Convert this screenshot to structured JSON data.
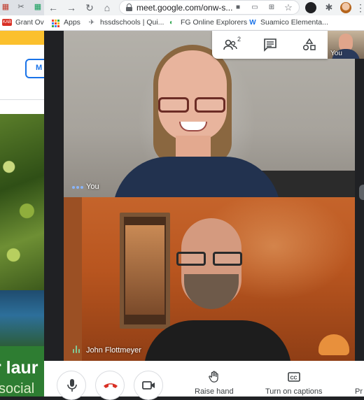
{
  "background_window": {
    "bookmark_badge": "KAB",
    "bookmark_text": "Grant Ove",
    "button_text": "M",
    "banner_text_line1": "r laur",
    "banner_text_line2": "social"
  },
  "browser": {
    "url": "meet.google.com/onw-s...",
    "bookmarks": [
      {
        "label": "Apps",
        "icon": "apps-grid-icon"
      },
      {
        "label": "hssdschools | Qui...",
        "icon": "bird-icon"
      },
      {
        "label": "FG Online Explorers",
        "icon": "fg-logo-icon"
      },
      {
        "label": "Suamico Elementa...",
        "icon": "w-logo-icon"
      }
    ]
  },
  "meet": {
    "people_count": "2",
    "self_preview_label": "You",
    "participants": [
      {
        "name": "You",
        "indicator": "dots-icon"
      },
      {
        "name": "John Flottmeyer",
        "indicator": "audio-level-icon"
      }
    ],
    "controls": {
      "raise_hand": "Raise hand",
      "captions": "Turn on captions",
      "present_partial": "Pr"
    }
  },
  "colors": {
    "meet_bg": "#202124",
    "hangup_red": "#d93025",
    "accent_blue": "#1a73e8",
    "speaking_green": "#81c995"
  }
}
